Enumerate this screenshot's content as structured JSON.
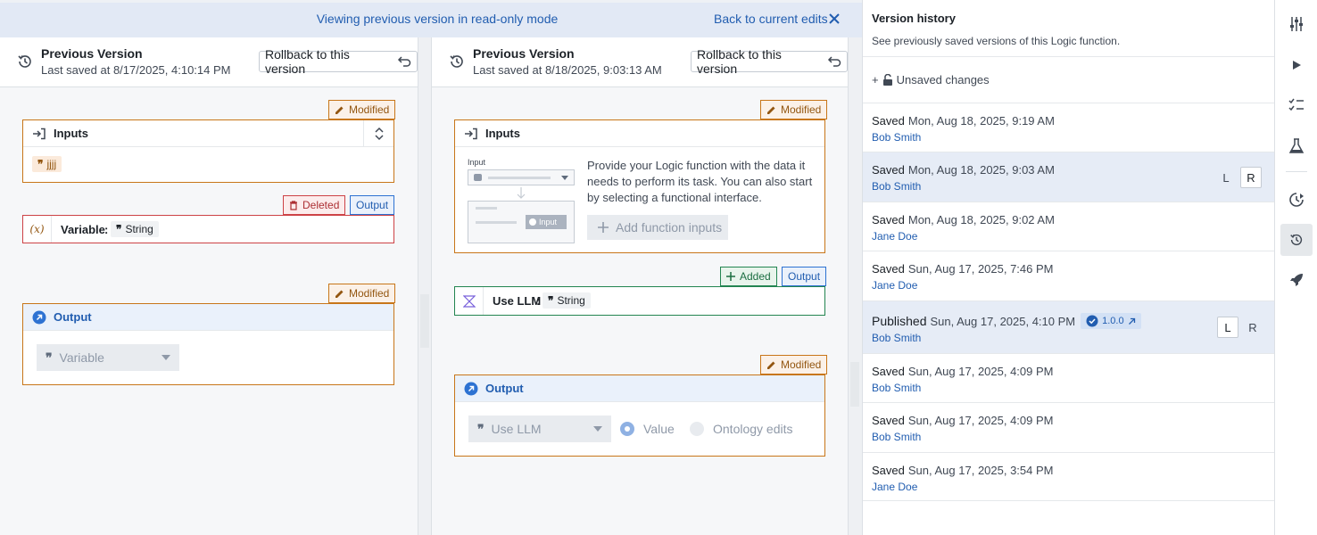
{
  "banner": {
    "message": "Viewing previous version in read-only mode",
    "back_link": "Back to current edits"
  },
  "left_pane": {
    "title": "Previous Version",
    "saved": "Last saved at 8/17/2025, 4:10:14 PM",
    "rollback_label": "Rollback to this version",
    "inputs_tag": "Modified",
    "inputs_title": "Inputs",
    "input_chip": "jjjj",
    "variable_tag_deleted": "Deleted",
    "variable_tag_output": "Output",
    "variable_name": "Variable",
    "variable_type": "String",
    "output_tag": "Modified",
    "output_title": "Output",
    "output_select": "Variable"
  },
  "right_pane": {
    "title": "Previous Version",
    "saved": "Last saved at 8/18/2025, 9:03:13 AM",
    "rollback_label": "Rollback to this version",
    "inputs_tag": "Modified",
    "inputs_title": "Inputs",
    "illustration_label": "Input",
    "illustration_button": "Input",
    "inputs_description": "Provide your Logic function with the data it needs to perform its task. You can also start by selecting a functional interface.",
    "add_inputs_label": "Add function inputs",
    "llm_tag_added": "Added",
    "llm_tag_output": "Output",
    "llm_name": "Use LLM",
    "llm_type": "String",
    "output_tag": "Modified",
    "output_title": "Output",
    "output_select": "Use LLM",
    "radio_value": "Value",
    "radio_ontology": "Ontology edits"
  },
  "version_history": {
    "title": "Version history",
    "description": "See previously saved versions of this Logic function.",
    "unsaved_label": "Unsaved changes",
    "compare_left": "L",
    "compare_right": "R",
    "entries": [
      {
        "status": "Saved",
        "date": "Mon, Aug 18, 2025, 9:19 AM",
        "author": "Bob Smith"
      },
      {
        "status": "Saved",
        "date": "Mon, Aug 18, 2025, 9:03 AM",
        "author": "Bob Smith",
        "compare": "R"
      },
      {
        "status": "Saved",
        "date": "Mon, Aug 18, 2025, 9:02 AM",
        "author": "Jane Doe"
      },
      {
        "status": "Saved",
        "date": "Sun, Aug 17, 2025, 7:46 PM",
        "author": "Jane Doe"
      },
      {
        "status": "Published",
        "date": "Sun, Aug 17, 2025, 4:10 PM",
        "author": "Bob Smith",
        "version": "1.0.0",
        "compare": "L"
      },
      {
        "status": "Saved",
        "date": "Sun, Aug 17, 2025, 4:09 PM",
        "author": "Bob Smith"
      },
      {
        "status": "Saved",
        "date": "Sun, Aug 17, 2025, 4:09 PM",
        "author": "Bob Smith"
      },
      {
        "status": "Saved",
        "date": "Sun, Aug 17, 2025, 3:54 PM",
        "author": "Jane Doe"
      }
    ]
  },
  "toolbar": {
    "icons": [
      "sliders-icon",
      "play-icon",
      "checklist-icon",
      "flask-icon",
      "run-history-icon",
      "history-icon",
      "rocket-icon"
    ],
    "active": "history-icon"
  },
  "colors": {
    "accent": "#215db0",
    "modified": "#c87619",
    "deleted": "#cd4246",
    "added": "#238551",
    "selected_row": "#e6ecf6"
  }
}
